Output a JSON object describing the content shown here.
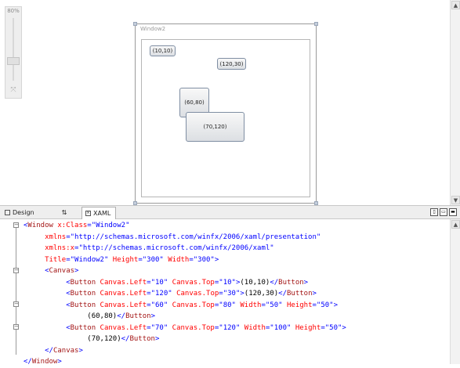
{
  "designer": {
    "zoom_label": "80%",
    "window_title": "Window2",
    "buttons": [
      {
        "label": "(10,10)"
      },
      {
        "label": "(120,30)"
      },
      {
        "label": "(60,80)"
      },
      {
        "label": "(70,120)"
      }
    ]
  },
  "tabs": {
    "design": "Design",
    "swap": "⇅",
    "xaml": "XAML"
  },
  "colors": {
    "markup_blue": "#0000ff",
    "element_brown": "#a31515",
    "attribute_red": "#ff0000"
  },
  "xaml_lines": [
    [
      {
        "c": "b",
        "t": "<"
      },
      {
        "c": "n",
        "t": "Window"
      },
      {
        "c": "a",
        "t": " x:Class"
      },
      {
        "c": "b",
        "t": "=\"Window2\""
      }
    ],
    [
      {
        "c": "x",
        "t": "     "
      },
      {
        "c": "a",
        "t": "xmlns"
      },
      {
        "c": "b",
        "t": "=\"http://schemas.microsoft.com/winfx/2006/xaml/presentation\""
      }
    ],
    [
      {
        "c": "x",
        "t": "     "
      },
      {
        "c": "a",
        "t": "xmlns:x"
      },
      {
        "c": "b",
        "t": "=\"http://schemas.microsoft.com/winfx/2006/xaml\""
      }
    ],
    [
      {
        "c": "x",
        "t": "     "
      },
      {
        "c": "a",
        "t": "Title"
      },
      {
        "c": "b",
        "t": "=\"Window2\""
      },
      {
        "c": "a",
        "t": " Height"
      },
      {
        "c": "b",
        "t": "=\"300\""
      },
      {
        "c": "a",
        "t": " Width"
      },
      {
        "c": "b",
        "t": "=\"300\">"
      }
    ],
    [
      {
        "c": "x",
        "t": "     "
      },
      {
        "c": "b",
        "t": "<"
      },
      {
        "c": "n",
        "t": "Canvas"
      },
      {
        "c": "b",
        "t": ">"
      }
    ],
    [
      {
        "c": "x",
        "t": "          "
      },
      {
        "c": "b",
        "t": "<"
      },
      {
        "c": "n",
        "t": "Button"
      },
      {
        "c": "a",
        "t": " Canvas.Left"
      },
      {
        "c": "b",
        "t": "=\"10\""
      },
      {
        "c": "a",
        "t": " Canvas.Top"
      },
      {
        "c": "b",
        "t": "=\"10\">"
      },
      {
        "c": "x",
        "t": "(10,10)"
      },
      {
        "c": "b",
        "t": "</"
      },
      {
        "c": "n",
        "t": "Button"
      },
      {
        "c": "b",
        "t": ">"
      }
    ],
    [
      {
        "c": "x",
        "t": "          "
      },
      {
        "c": "b",
        "t": "<"
      },
      {
        "c": "n",
        "t": "Button"
      },
      {
        "c": "a",
        "t": " Canvas.Left"
      },
      {
        "c": "b",
        "t": "=\"120\""
      },
      {
        "c": "a",
        "t": " Canvas.Top"
      },
      {
        "c": "b",
        "t": "=\"30\">"
      },
      {
        "c": "x",
        "t": "(120,30)"
      },
      {
        "c": "b",
        "t": "</"
      },
      {
        "c": "n",
        "t": "Button"
      },
      {
        "c": "b",
        "t": ">"
      }
    ],
    [
      {
        "c": "x",
        "t": "          "
      },
      {
        "c": "b",
        "t": "<"
      },
      {
        "c": "n",
        "t": "Button"
      },
      {
        "c": "a",
        "t": " Canvas.Left"
      },
      {
        "c": "b",
        "t": "=\"60\""
      },
      {
        "c": "a",
        "t": " Canvas.Top"
      },
      {
        "c": "b",
        "t": "=\"80\""
      },
      {
        "c": "a",
        "t": " Width"
      },
      {
        "c": "b",
        "t": "=\"50\""
      },
      {
        "c": "a",
        "t": " Height"
      },
      {
        "c": "b",
        "t": "=\"50\">"
      }
    ],
    [
      {
        "c": "x",
        "t": "               (60,80)"
      },
      {
        "c": "b",
        "t": "</"
      },
      {
        "c": "n",
        "t": "Button"
      },
      {
        "c": "b",
        "t": ">"
      }
    ],
    [
      {
        "c": "x",
        "t": "          "
      },
      {
        "c": "b",
        "t": "<"
      },
      {
        "c": "n",
        "t": "Button"
      },
      {
        "c": "a",
        "t": " Canvas.Left"
      },
      {
        "c": "b",
        "t": "=\"70\""
      },
      {
        "c": "a",
        "t": " Canvas.Top"
      },
      {
        "c": "b",
        "t": "=\"120\""
      },
      {
        "c": "a",
        "t": " Width"
      },
      {
        "c": "b",
        "t": "=\"100\""
      },
      {
        "c": "a",
        "t": " Height"
      },
      {
        "c": "b",
        "t": "=\"50\">"
      }
    ],
    [
      {
        "c": "x",
        "t": "               (70,120)"
      },
      {
        "c": "b",
        "t": "</"
      },
      {
        "c": "n",
        "t": "Button"
      },
      {
        "c": "b",
        "t": ">"
      }
    ],
    [
      {
        "c": "x",
        "t": "     "
      },
      {
        "c": "b",
        "t": "</"
      },
      {
        "c": "n",
        "t": "Canvas"
      },
      {
        "c": "b",
        "t": ">"
      }
    ],
    [
      {
        "c": "b",
        "t": "</"
      },
      {
        "c": "n",
        "t": "Window"
      },
      {
        "c": "b",
        "t": ">"
      }
    ]
  ]
}
